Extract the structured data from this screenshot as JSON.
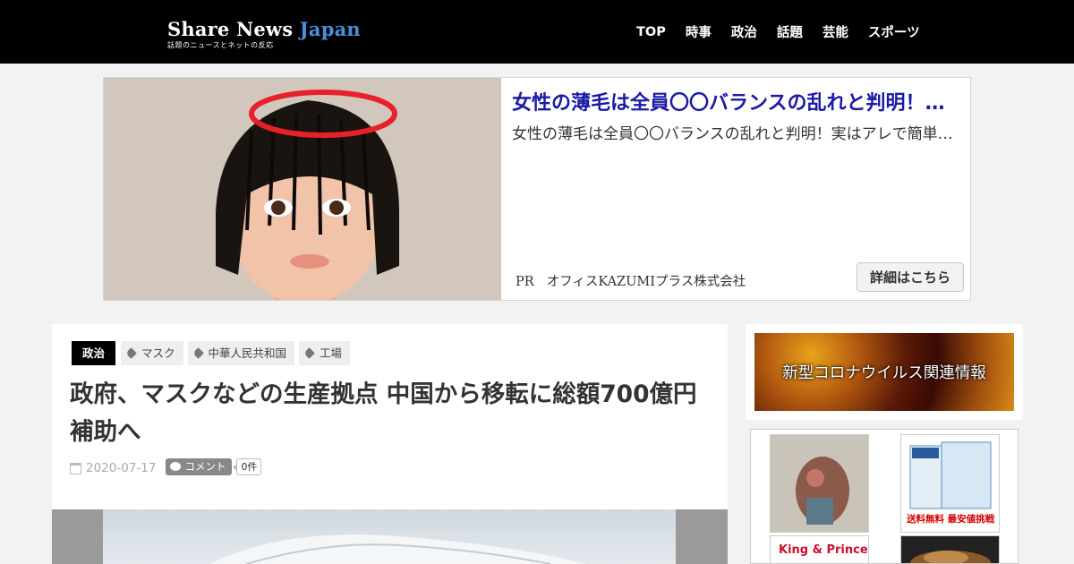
{
  "header": {
    "logo_main": "Share News",
    "logo_accent": "Japan",
    "logo_sub": "話題のニュースとネットの反応",
    "nav": [
      "TOP",
      "時事",
      "政治",
      "話題",
      "芸能",
      "スポーツ"
    ]
  },
  "ad": {
    "title": "女性の薄毛は全員〇〇バランスの乱れと判明！実はアレで簡単に…",
    "description": "女性の薄毛は全員〇〇バランスの乱れと判明！実はアレで簡単に改善できる",
    "pr_label": "PR",
    "sponsor": "オフィスKAZUMIプラス株式会社",
    "cta": "詳細はこちら"
  },
  "article": {
    "category": "政治",
    "tags": [
      "マスク",
      "中華人民共和国",
      "工場"
    ],
    "title": "政府、マスクなどの生産拠点 中国から移転に総額700億円補助へ",
    "date": "2020-07-17",
    "comment_label": "コメント",
    "comment_count": "0件"
  },
  "sidebar": {
    "banner_text": "新型コロナウイルス関連情報",
    "products": {
      "p2_label": "送料無料 最安値挑戦",
      "p3_label": "King & Prince"
    }
  },
  "colors": {
    "header_bg": "#000000",
    "logo_accent": "#4a8fd9",
    "ad_title": "#1a1aa6",
    "category_bg": "#000000"
  }
}
